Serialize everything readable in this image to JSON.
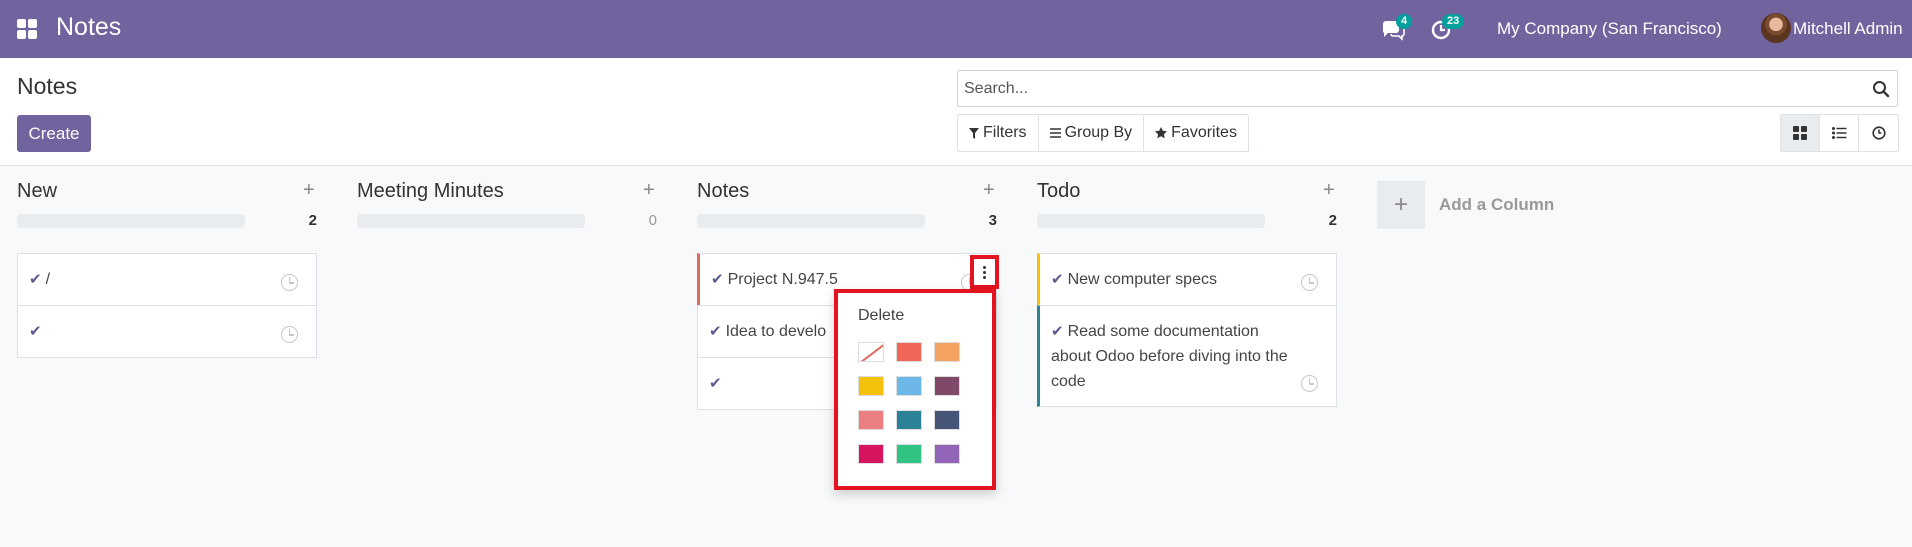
{
  "navbar": {
    "app_title": "Notes",
    "messages_count": "4",
    "activities_count": "23",
    "company": "My Company (San Francisco)",
    "user": "Mitchell Admin",
    "color": "#71639e"
  },
  "control_panel": {
    "title": "Notes",
    "create_label": "Create",
    "search_placeholder": "Search...",
    "filters_label": "Filters",
    "group_by_label": "Group By",
    "favorites_label": "Favorites",
    "views": [
      "kanban",
      "list",
      "activity"
    ],
    "active_view": "kanban"
  },
  "columns": [
    {
      "title": "New",
      "count": "2",
      "cards": [
        {
          "text": "/",
          "color": "none"
        },
        {
          "text": "",
          "color": "none"
        }
      ]
    },
    {
      "title": "Meeting Minutes",
      "count": "0",
      "cards": []
    },
    {
      "title": "Notes",
      "count": "3",
      "cards": [
        {
          "text": "Project N.947.5",
          "color": "#e06b5b"
        },
        {
          "text": "Idea to develo",
          "color": "none"
        },
        {
          "text": "",
          "color": "none"
        }
      ]
    },
    {
      "title": "Todo",
      "count": "2",
      "cards": [
        {
          "text": "New computer specs",
          "color": "#f4c20d"
        },
        {
          "text": "Read some documentation about Odoo before diving into the code",
          "color": "#2c8397"
        }
      ]
    }
  ],
  "add_column_label": "Add a Column",
  "card_menu": {
    "delete_label": "Delete",
    "colors": [
      "none",
      "#ef6658",
      "#f4a460",
      "#f4c20d",
      "#6cb6e8",
      "#814968",
      "#eb7e7f",
      "#2c8397",
      "#475577",
      "#d6145f",
      "#30c381",
      "#9365b8"
    ]
  }
}
